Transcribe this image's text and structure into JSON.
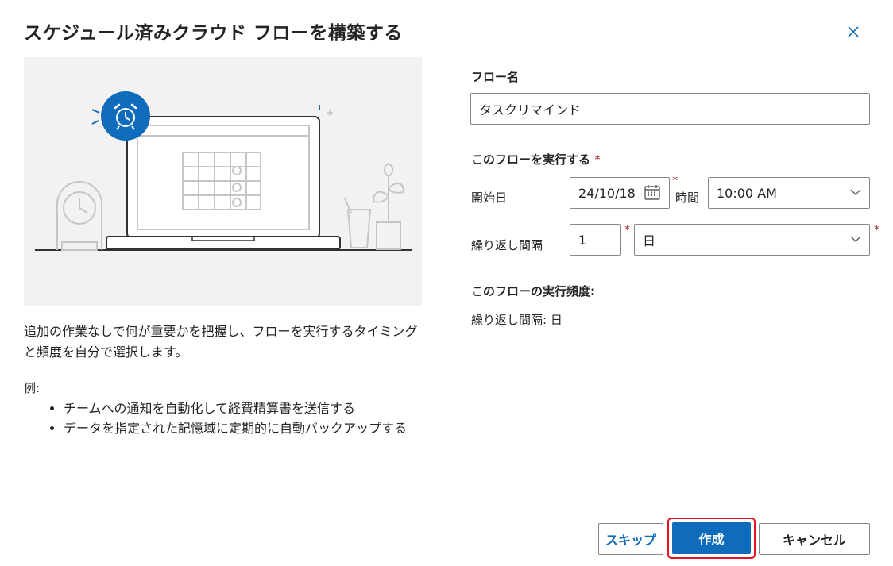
{
  "dialog": {
    "title": "スケジュール済みクラウド フローを構築する"
  },
  "left": {
    "description": "追加の作業なしで何が重要かを把握し、フローを実行するタイミングと頻度を自分で選択します。",
    "examples_label": "例:",
    "examples": [
      "チームへの通知を自動化して経費精算書を送信する",
      "データを指定された記憶域に定期的に自動バックアップする"
    ]
  },
  "form": {
    "flow_name_label": "フロー名",
    "flow_name_value": "タスクリマインド",
    "run_label": "このフローを実行する",
    "required_mark": "*",
    "start_date_label": "開始日",
    "start_date_value": "24/10/18",
    "time_label": "時間",
    "time_value": "10:00 AM",
    "interval_label": "繰り返し間隔",
    "interval_value": "1",
    "interval_unit": "日",
    "summary_label": "このフローの実行頻度:",
    "summary_text": "繰り返し間隔: 日"
  },
  "buttons": {
    "skip": "スキップ",
    "create": "作成",
    "cancel": "キャンセル"
  },
  "colors": {
    "accent": "#0f6cbd",
    "required": "#a4262c",
    "highlight": "#e81123"
  }
}
